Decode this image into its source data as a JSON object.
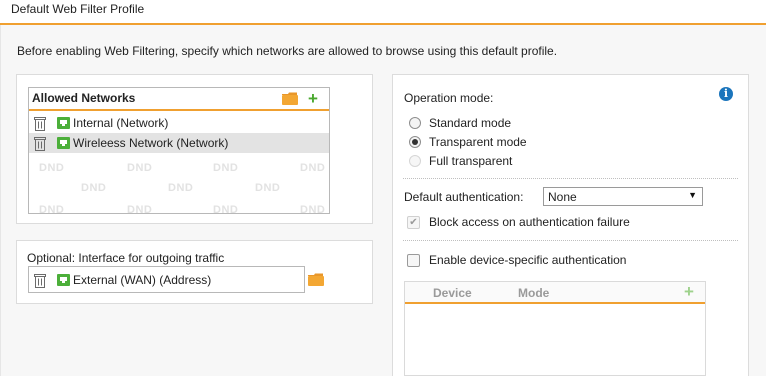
{
  "window": {
    "title": "Default Web Filter Profile"
  },
  "intro": "Before enabling Web Filtering, specify which networks are allowed to browse using this default profile.",
  "allowed_networks": {
    "title": "Allowed Networks",
    "items": [
      {
        "label": "Internal (Network)",
        "selected": false
      },
      {
        "label": "Wireleess Network (Network)",
        "selected": true
      }
    ],
    "dnd_text": "DND"
  },
  "outgoing": {
    "label": "Optional: Interface for outgoing traffic",
    "value": "External (WAN) (Address)"
  },
  "operation_mode": {
    "label": "Operation mode:",
    "options": [
      {
        "label": "Standard mode",
        "checked": false,
        "disabled": false
      },
      {
        "label": "Transparent mode",
        "checked": true,
        "disabled": false
      },
      {
        "label": "Full transparent",
        "checked": false,
        "disabled": true
      }
    ]
  },
  "default_auth": {
    "label": "Default authentication:",
    "value": "None"
  },
  "block_access": {
    "label": "Block access on authentication failure",
    "checked": true,
    "disabled": true
  },
  "device_specific": {
    "label": "Enable device-specific authentication",
    "checked": false
  },
  "device_table": {
    "columns": [
      "Device",
      "Mode"
    ]
  },
  "colors": {
    "accent": "#f0a030",
    "green": "#49a82e",
    "info_blue": "#1b75bc"
  },
  "icons": [
    "trash-icon",
    "network-icon",
    "folder-icon",
    "plus-icon",
    "info-icon"
  ]
}
